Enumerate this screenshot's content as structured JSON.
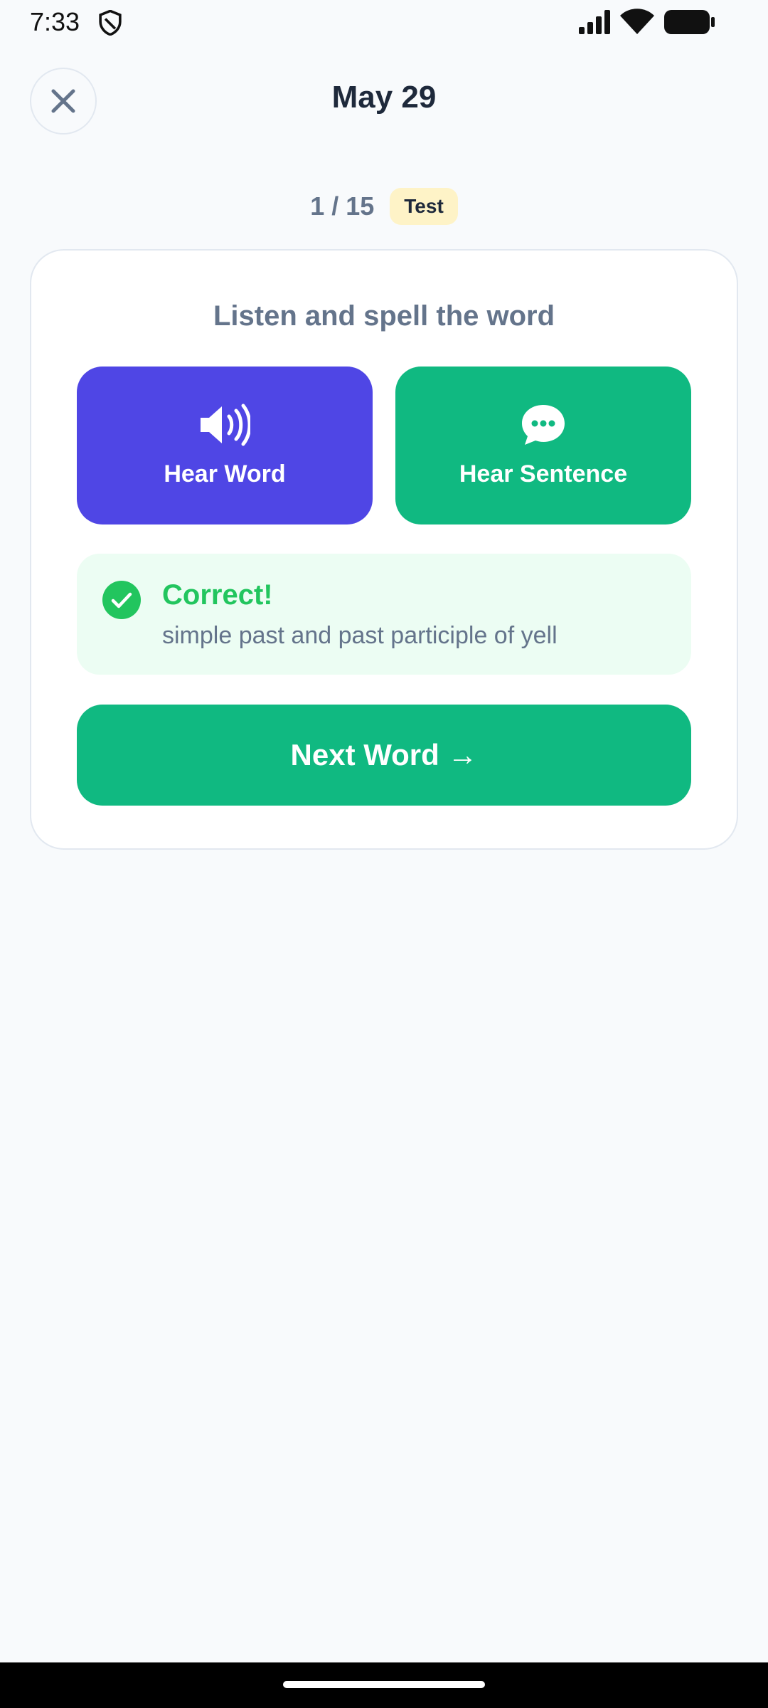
{
  "status_bar": {
    "time": "7:33"
  },
  "header": {
    "title": "May 29"
  },
  "progress": {
    "text": "1 / 15",
    "badge": "Test"
  },
  "card": {
    "prompt": "Listen and spell the word",
    "hear_word_label": "Hear Word",
    "hear_sentence_label": "Hear Sentence",
    "feedback": {
      "title": "Correct!",
      "detail": "simple past and past participle of yell"
    },
    "next_label": "Next Word →"
  },
  "icons": {
    "close": "close-icon",
    "hear_word": "speaker-icon",
    "hear_sentence": "chat-bubble-icon",
    "feedback": "check-circle-icon"
  },
  "colors": {
    "hear_word_bg": "#4f46e5",
    "hear_sentence_bg": "#10b981",
    "correct_text": "#22c55e",
    "feedback_bg": "#ecfdf3",
    "badge_bg": "#fef3c7"
  }
}
